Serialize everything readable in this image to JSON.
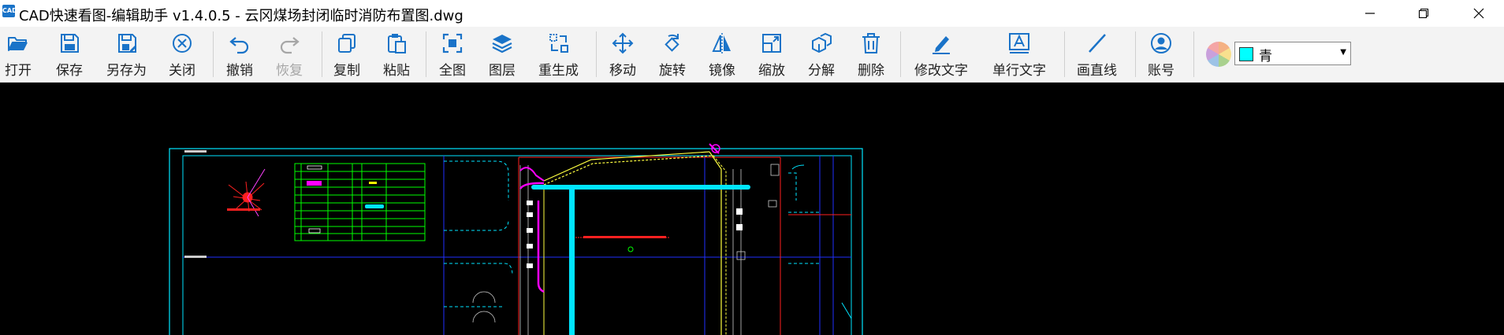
{
  "window": {
    "title": "CAD快速看图-编辑助手 v1.4.0.5 - 云冈煤场封闭临时消防布置图.dwg",
    "app_icon_text": "CAD"
  },
  "toolbar": {
    "open": "打开",
    "save": "保存",
    "save_as": "另存为",
    "close": "关闭",
    "undo": "撤销",
    "redo": "恢复",
    "copy": "复制",
    "paste": "粘贴",
    "fit_all": "全图",
    "layers": "图层",
    "regen": "重生成",
    "move": "移动",
    "rotate": "旋转",
    "mirror": "镜像",
    "scale": "缩放",
    "explode": "分解",
    "delete": "删除",
    "edit_text": "修改文字",
    "single_text": "单行文字",
    "draw_line": "画直线",
    "account": "账号"
  },
  "color_picker": {
    "selected_name": "青",
    "selected_color": "#00ffff"
  },
  "colors": {
    "accent_blue": "#1a73c8",
    "cad_cyan": "#00e5ff",
    "cad_magenta": "#ff00ff",
    "cad_green": "#00ff00",
    "cad_red": "#ff2020",
    "cad_blue": "#2020ff"
  }
}
